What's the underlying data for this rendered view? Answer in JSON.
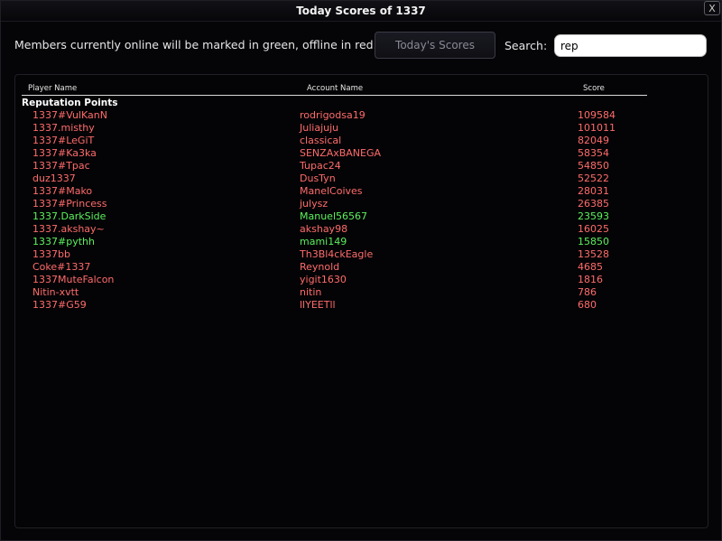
{
  "window": {
    "title": "Today Scores of 1337",
    "close_label": "X"
  },
  "toolbar": {
    "legend_text": "Members currently online will be marked in green, offline in red.",
    "scores_button_label": "Today's Scores",
    "search_label": "Search:",
    "search_value": "rep"
  },
  "table": {
    "headers": {
      "player": "Player Name",
      "account": "Account Name",
      "score": "Score"
    },
    "section_title": "Reputation Points",
    "status_colors": {
      "online": "#5cf05c",
      "offline": "#ff6b6b"
    },
    "rows": [
      {
        "player": "1337#VulKanN",
        "account": "rodrigodsa19",
        "score": "109584",
        "online": false
      },
      {
        "player": "1337.misthy",
        "account": "Juliajuju",
        "score": "101011",
        "online": false
      },
      {
        "player": "1337#LeGiT",
        "account": "classical",
        "score": "82049",
        "online": false
      },
      {
        "player": "1337#Ka3ka",
        "account": "SENZAxBANEGA",
        "score": "58354",
        "online": false
      },
      {
        "player": "1337#Tpac",
        "account": "Tupac24",
        "score": "54850",
        "online": false
      },
      {
        "player": "duz1337",
        "account": "DusTyn",
        "score": "52522",
        "online": false
      },
      {
        "player": "1337#Mako",
        "account": "ManelCoives",
        "score": "28031",
        "online": false
      },
      {
        "player": "1337#Princess",
        "account": "julysz",
        "score": "26385",
        "online": false
      },
      {
        "player": "1337.DarkSide",
        "account": "Manuel56567",
        "score": "23593",
        "online": true
      },
      {
        "player": "1337.akshay~",
        "account": "akshay98",
        "score": "16025",
        "online": false
      },
      {
        "player": "1337#pythh",
        "account": "mami149",
        "score": "15850",
        "online": true
      },
      {
        "player": "1337bb",
        "account": "Th3Bl4ckEagle",
        "score": "13528",
        "online": false
      },
      {
        "player": "Coke#1337",
        "account": "Reynold",
        "score": "4685",
        "online": false
      },
      {
        "player": "1337MuteFalcon",
        "account": "yigit1630",
        "score": "1816",
        "online": false
      },
      {
        "player": "Nitin-xvtt",
        "account": "nitin",
        "score": "786",
        "online": false
      },
      {
        "player": "1337#G59",
        "account": "llYEETll",
        "score": "680",
        "online": false
      }
    ]
  }
}
